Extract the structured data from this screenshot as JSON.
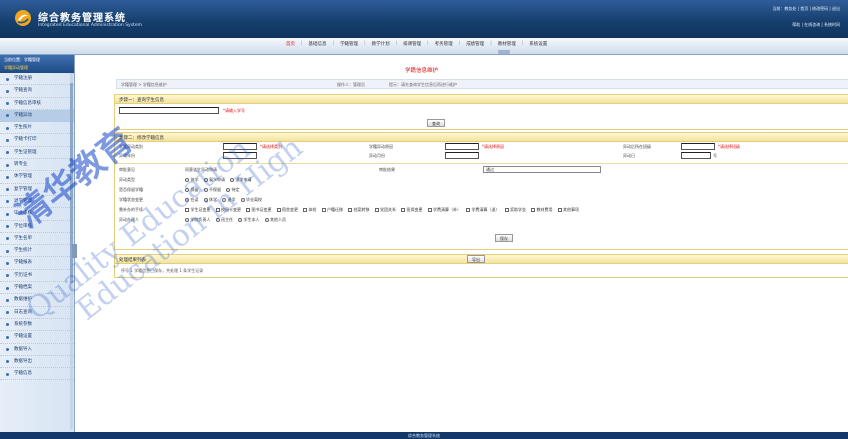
{
  "header": {
    "title": "综合教务管理系统",
    "subtitle": "Integrated Educational Administration System",
    "user_info": "当前：教务处 | 首页 | 修改密码 | 退出",
    "user_links": "帮助 | 在线咨询 | 系统时间"
  },
  "menu": {
    "items": [
      "首页",
      "基础信息",
      "学籍管理",
      "教学计划",
      "排课管理",
      "考务管理",
      "成绩管理",
      "教材管理",
      "系统设置"
    ]
  },
  "sidebar": {
    "head1": "当前位置：学籍管理",
    "head2": "学籍异动管理",
    "items": [
      "学籍注册",
      "学籍查询",
      "学籍信息审核",
      "学籍异动",
      "学生照片",
      "学籍卡打印",
      "学生证管理",
      "转专业",
      "休学管理",
      "复学管理",
      "退学管理",
      "毕业审核",
      "学位审核",
      "学生名单",
      "学生统计",
      "学籍报表",
      "学历证书",
      "学籍档案",
      "数据维护",
      "日志查询",
      "系统参数",
      "学籍设置",
      "数据导入",
      "数据导出",
      "学籍信息"
    ]
  },
  "page": {
    "title": "学籍信息维护",
    "crumb_left": "学籍管理 > 学籍信息维护",
    "crumb_mid": "操作人：管理员",
    "crumb_right": "提示：请先查询学生信息后再进行维护"
  },
  "step1": {
    "head": "步骤一：查询学生信息",
    "input_value": "",
    "hint": "*请输入学号",
    "button": "查询"
  },
  "step2": {
    "head": "步骤二：修改学籍信息",
    "f1_label": "学籍异动类别",
    "f1_hint": "*请选择类别",
    "f2_label": "学籍异动原因",
    "f2_hint": "*请选择原因",
    "f3_label": "异动后所在班级",
    "f3_hint": "*请选择班级",
    "year_label": "异动年份",
    "month_label": "异动月份",
    "day_label": "异动日",
    "day_unit": "号",
    "row2_label": "审批意见",
    "row2_value": "同意该生异动申请",
    "row2_right_label": "审批结果",
    "row2_select": "通过",
    "r1_label": "异动类型",
    "r1_opts": [
      "休学",
      "复学申请",
      "退学申请"
    ],
    "r2_label": "是否保留学籍",
    "r2_opts": [
      "保留",
      "不保留",
      "待定"
    ],
    "r3_label": "学籍状态变更",
    "r3_opts": [
      "在读",
      "休学",
      "退学",
      "毕业离校"
    ],
    "r4_label": "需补办的手续",
    "r4_opts": [
      "学生证变更",
      "校园卡变更",
      "图书证变更",
      "宿舍变更",
      "体检",
      "户籍迁移",
      "档案转移",
      "党团关系",
      "医保变更",
      "学费清算（补）",
      "学费清算（退）",
      "奖助学金",
      "教材费用",
      "其他事项"
    ],
    "r5_label": "异动办理人",
    "r5_opts": [
      "学院负责人",
      "班主任",
      "学生本人",
      "其他人员"
    ],
    "button": "保存"
  },
  "result": {
    "head": "处理结果列表",
    "export_button": "导出",
    "line": "序号 1  学籍信息已保存，共处理 1 条学生记录"
  },
  "footer": {
    "text": "综合教务管理系统"
  },
  "watermark": {
    "w1": "清华教育",
    "w2": "Quality Education",
    "w3": "Education in High"
  }
}
